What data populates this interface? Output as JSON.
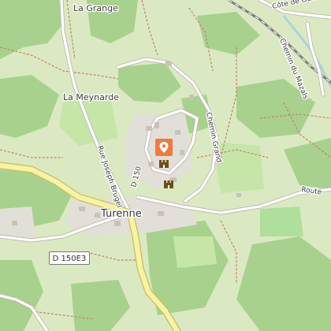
{
  "map": {
    "labels": {
      "la_grange": "La Grange",
      "la_meynarde": "La Meynarde",
      "turenne": "Turenne",
      "rue_joseph_bruge": "Rue Joseph Brugel",
      "d150": "D 150",
      "chemin_grand": "Chemin Grand",
      "chemin_du_mazals": "Chemin du Mazals",
      "route": "Route",
      "cote_de_gernes": "Côte de Gernes",
      "d150e3": "D 150E3"
    },
    "colors": {
      "background": "#dbe9c2",
      "forest": "#a9d18e",
      "meadow": "#c6e6a8",
      "orchard": "#aedf9b",
      "residential": "#e2dfd9",
      "main_road": "#f7f3a3",
      "main_road_casing": "#c8bd5e",
      "minor_road": "#ffffff",
      "path": "#c4826a",
      "railway": "#7d7d7d",
      "water": "#aad3df",
      "marker": "#f07a3c",
      "castle_icon": "#6e4e1a"
    },
    "icons": {
      "marker": "location-pin-icon",
      "castle_1": "castle-icon",
      "castle_2": "castle-icon",
      "building": "building-icon"
    }
  }
}
